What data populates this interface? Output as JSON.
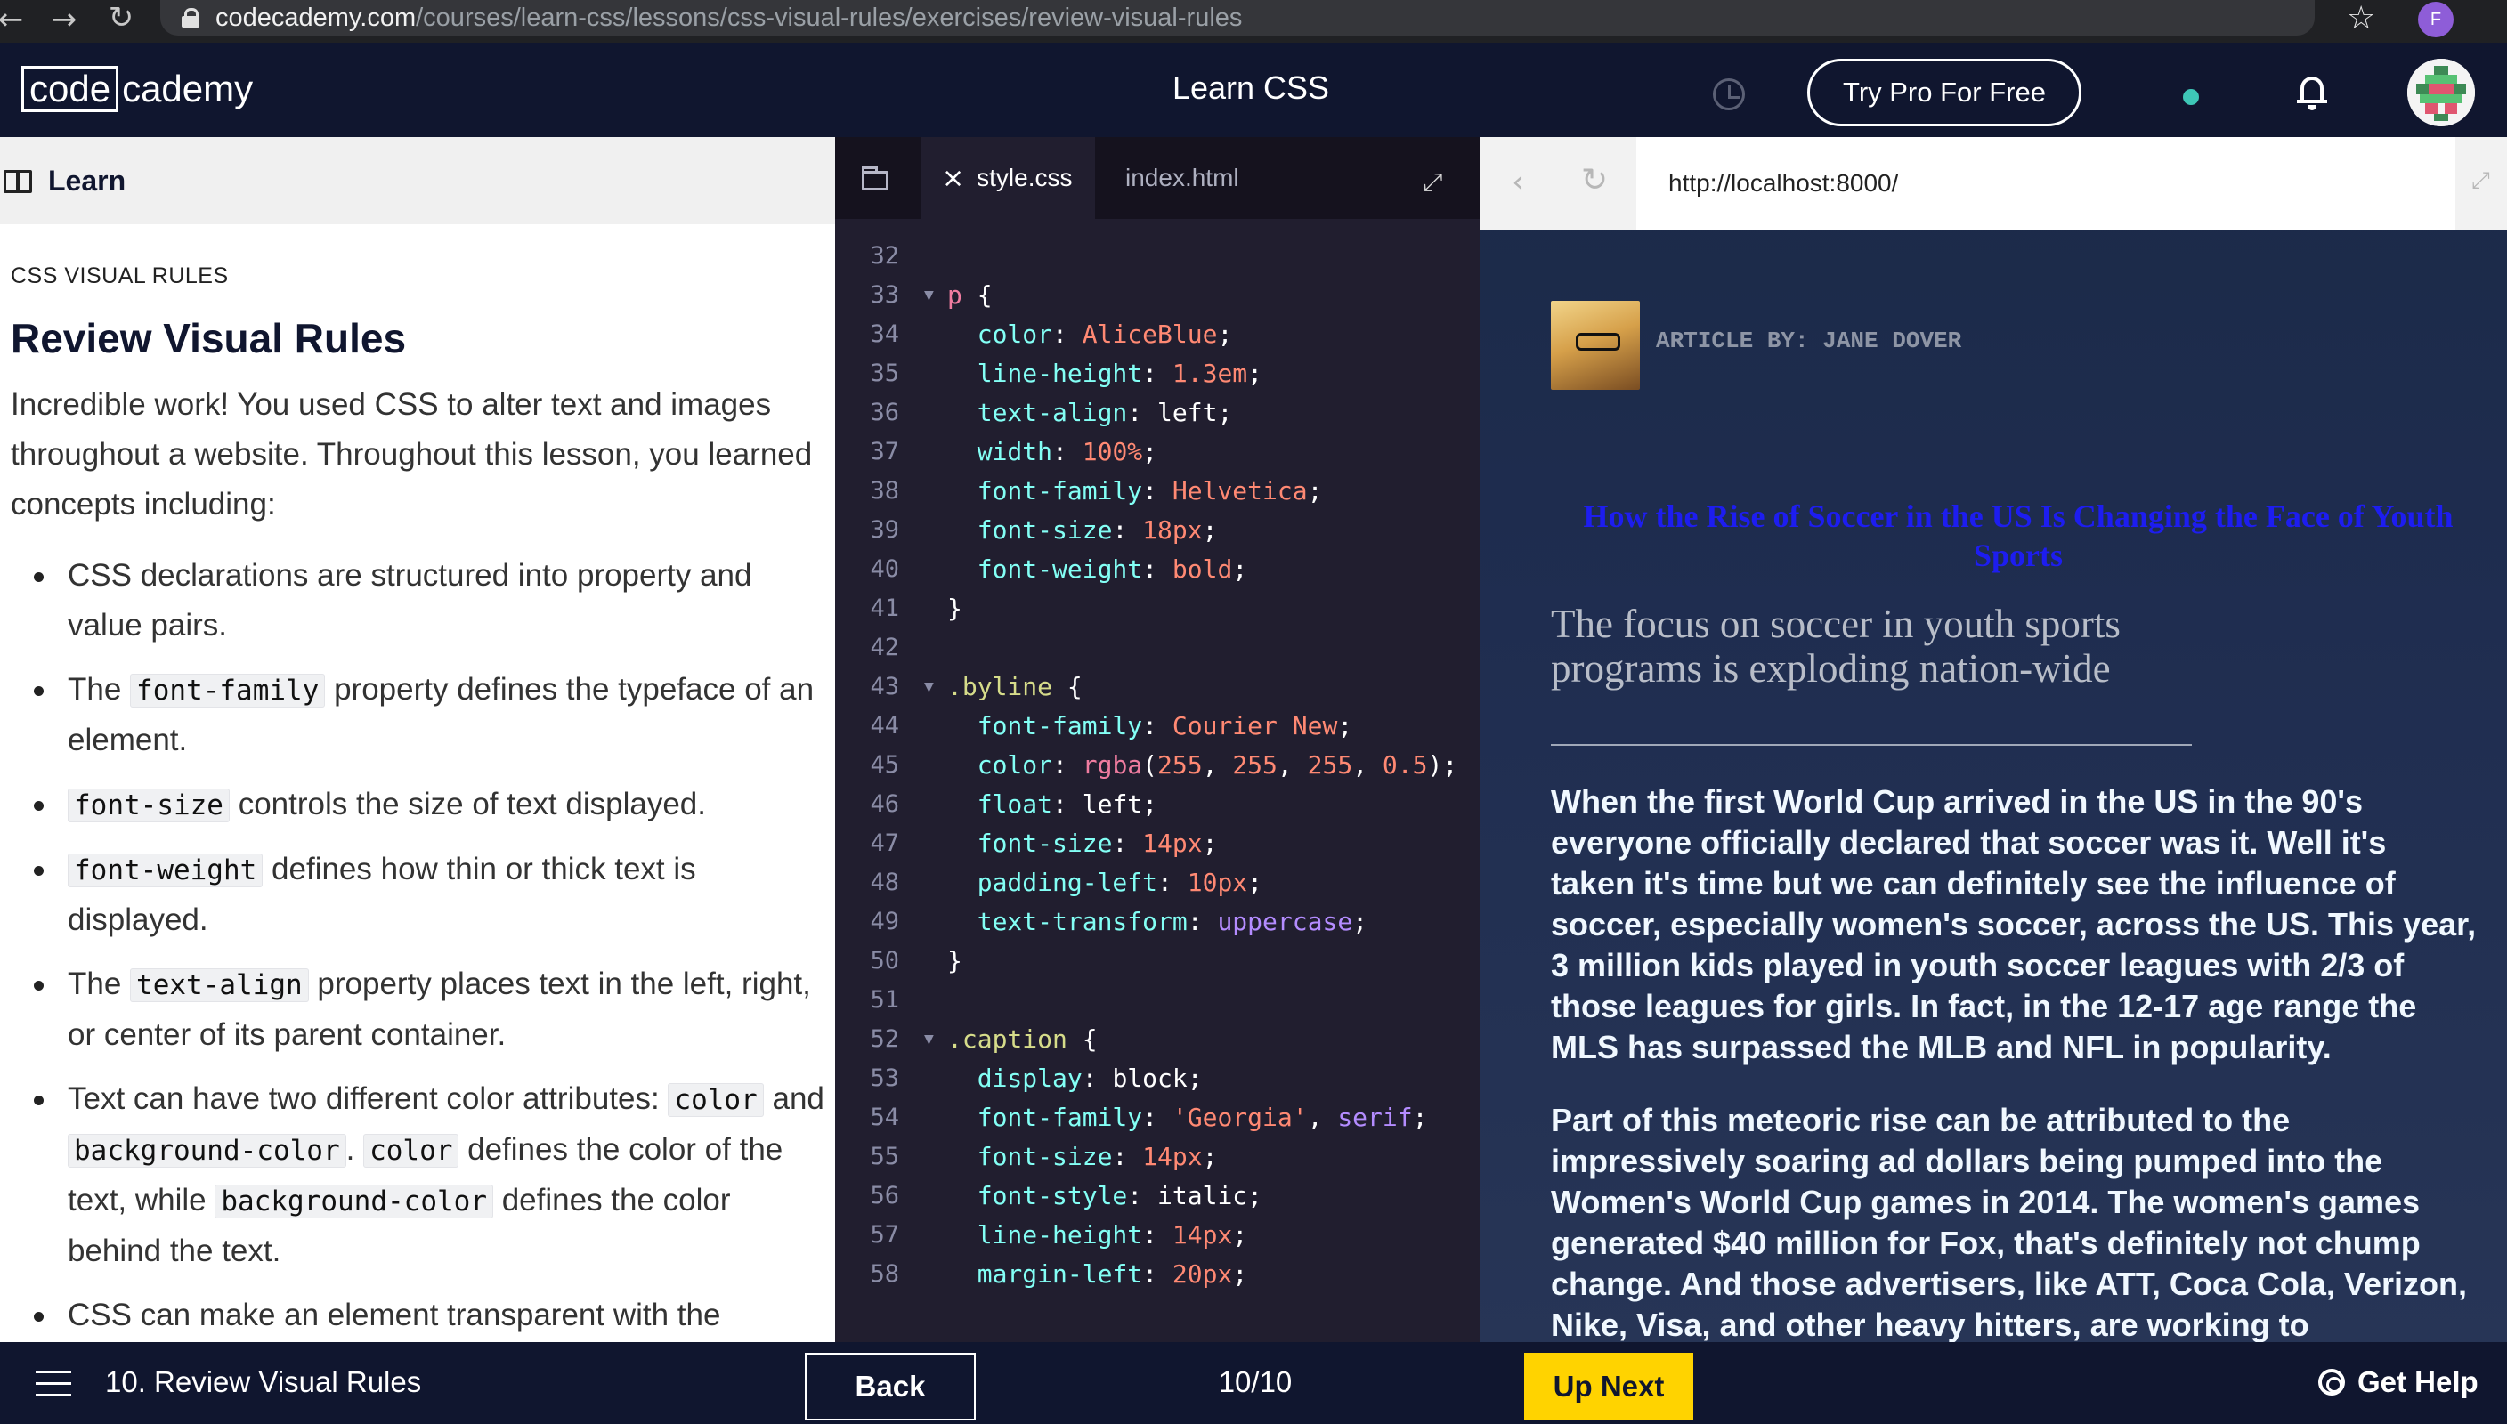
{
  "browser": {
    "back_icon": "arrow-left",
    "forward_icon": "arrow-right",
    "reload_icon": "reload",
    "url_host": "codecademy.com",
    "url_path": "/courses/learn-css/lessons/css-visual-rules/exercises/review-visual-rules",
    "profile_initial": "F",
    "profile_color": "#8e5dd8"
  },
  "header": {
    "logo_code": "code",
    "logo_academy": "cademy",
    "title": "Learn CSS",
    "pro_button": "Try Pro For Free",
    "accent_dot_color": "#3ec7b7"
  },
  "learn": {
    "panel_label": "Learn",
    "section": "CSS VISUAL RULES",
    "title": "Review Visual Rules",
    "intro": "Incredible work! You used CSS to alter text and images throughout a website. Throughout this lesson, you learned concepts including:",
    "bullets": {
      "b1": "CSS declarations are structured into property and value pairs.",
      "b2_pre": "The ",
      "b2_code": "font-family",
      "b2_post": " property defines the typeface of an element.",
      "b3_code": "font-size",
      "b3_post": " controls the size of text displayed.",
      "b4_code": "font-weight",
      "b4_post": " defines how thin or thick text is displayed.",
      "b5_pre": "The ",
      "b5_code": "text-align",
      "b5_post": " property places text in the left, right, or center of its parent container.",
      "b6_pre": "Text can have two different color attributes: ",
      "b6_code1": "color",
      "b6_mid1": " and ",
      "b6_code2": "background-color",
      "b6_mid2": ". ",
      "b6_code3": "color",
      "b6_mid3": " defines the color of the text, while ",
      "b6_code4": "background-color",
      "b6_post": " defines the color behind the text.",
      "b7": "CSS can make an element transparent with the"
    }
  },
  "editor": {
    "tab_active": "style.css",
    "tab_inactive": "index.html",
    "lines": [
      {
        "n": "32",
        "fold": false,
        "parts": []
      },
      {
        "n": "33",
        "fold": true,
        "parts": [
          [
            "sel",
            "p"
          ],
          [
            "pun",
            " {"
          ]
        ]
      },
      {
        "n": "34",
        "fold": false,
        "parts": [
          [
            "pun",
            "  "
          ],
          [
            "prop",
            "color"
          ],
          [
            "pun",
            ": "
          ],
          [
            "val",
            "AliceBlue"
          ],
          [
            "pun",
            ";"
          ]
        ]
      },
      {
        "n": "35",
        "fold": false,
        "parts": [
          [
            "pun",
            "  "
          ],
          [
            "prop",
            "line-height"
          ],
          [
            "pun",
            ": "
          ],
          [
            "num",
            "1.3em"
          ],
          [
            "pun",
            ";"
          ]
        ]
      },
      {
        "n": "36",
        "fold": false,
        "parts": [
          [
            "pun",
            "  "
          ],
          [
            "prop",
            "text-align"
          ],
          [
            "pun",
            ": "
          ],
          [
            "pun",
            "left"
          ],
          [
            "pun",
            ";"
          ]
        ]
      },
      {
        "n": "37",
        "fold": false,
        "parts": [
          [
            "pun",
            "  "
          ],
          [
            "prop",
            "width"
          ],
          [
            "pun",
            ": "
          ],
          [
            "num",
            "100%"
          ],
          [
            "pun",
            ";"
          ]
        ]
      },
      {
        "n": "38",
        "fold": false,
        "parts": [
          [
            "pun",
            "  "
          ],
          [
            "prop",
            "font-family"
          ],
          [
            "pun",
            ": "
          ],
          [
            "val",
            "Helvetica"
          ],
          [
            "pun",
            ";"
          ]
        ]
      },
      {
        "n": "39",
        "fold": false,
        "parts": [
          [
            "pun",
            "  "
          ],
          [
            "prop",
            "font-size"
          ],
          [
            "pun",
            ": "
          ],
          [
            "num",
            "18px"
          ],
          [
            "pun",
            ";"
          ]
        ]
      },
      {
        "n": "40",
        "fold": false,
        "parts": [
          [
            "pun",
            "  "
          ],
          [
            "prop",
            "font-weight"
          ],
          [
            "pun",
            ": "
          ],
          [
            "val",
            "bold"
          ],
          [
            "pun",
            ";"
          ]
        ]
      },
      {
        "n": "41",
        "fold": false,
        "parts": [
          [
            "pun",
            "}"
          ]
        ]
      },
      {
        "n": "42",
        "fold": false,
        "parts": []
      },
      {
        "n": "43",
        "fold": true,
        "parts": [
          [
            "cls",
            ".byline"
          ],
          [
            "pun",
            " {"
          ]
        ]
      },
      {
        "n": "44",
        "fold": false,
        "parts": [
          [
            "pun",
            "  "
          ],
          [
            "prop",
            "font-family"
          ],
          [
            "pun",
            ": "
          ],
          [
            "val",
            "Courier New"
          ],
          [
            "pun",
            ";"
          ]
        ]
      },
      {
        "n": "45",
        "fold": false,
        "parts": [
          [
            "pun",
            "  "
          ],
          [
            "prop",
            "color"
          ],
          [
            "pun",
            ": "
          ],
          [
            "sel",
            "rgba"
          ],
          [
            "pun",
            "("
          ],
          [
            "num",
            "255"
          ],
          [
            "pun",
            ", "
          ],
          [
            "num",
            "255"
          ],
          [
            "pun",
            ", "
          ],
          [
            "num",
            "255"
          ],
          [
            "pun",
            ", "
          ],
          [
            "num",
            "0.5"
          ],
          [
            "pun",
            ");"
          ]
        ]
      },
      {
        "n": "46",
        "fold": false,
        "parts": [
          [
            "pun",
            "  "
          ],
          [
            "prop",
            "float"
          ],
          [
            "pun",
            ": "
          ],
          [
            "pun",
            "left"
          ],
          [
            "pun",
            ";"
          ]
        ]
      },
      {
        "n": "47",
        "fold": false,
        "parts": [
          [
            "pun",
            "  "
          ],
          [
            "prop",
            "font-size"
          ],
          [
            "pun",
            ": "
          ],
          [
            "num",
            "14px"
          ],
          [
            "pun",
            ";"
          ]
        ]
      },
      {
        "n": "48",
        "fold": false,
        "parts": [
          [
            "pun",
            "  "
          ],
          [
            "prop",
            "padding-left"
          ],
          [
            "pun",
            ": "
          ],
          [
            "num",
            "10px"
          ],
          [
            "pun",
            ";"
          ]
        ]
      },
      {
        "n": "49",
        "fold": false,
        "parts": [
          [
            "pun",
            "  "
          ],
          [
            "prop",
            "text-transform"
          ],
          [
            "pun",
            ": "
          ],
          [
            "kw",
            "uppercase"
          ],
          [
            "pun",
            ";"
          ]
        ]
      },
      {
        "n": "50",
        "fold": false,
        "parts": [
          [
            "pun",
            "}"
          ]
        ]
      },
      {
        "n": "51",
        "fold": false,
        "parts": []
      },
      {
        "n": "52",
        "fold": true,
        "parts": [
          [
            "cls",
            ".caption"
          ],
          [
            "pun",
            " {"
          ]
        ]
      },
      {
        "n": "53",
        "fold": false,
        "parts": [
          [
            "pun",
            "  "
          ],
          [
            "prop",
            "display"
          ],
          [
            "pun",
            ": "
          ],
          [
            "pun",
            "block"
          ],
          [
            "pun",
            ";"
          ]
        ]
      },
      {
        "n": "54",
        "fold": false,
        "parts": [
          [
            "pun",
            "  "
          ],
          [
            "prop",
            "font-family"
          ],
          [
            "pun",
            ": "
          ],
          [
            "val",
            "'Georgia'"
          ],
          [
            "pun",
            ", "
          ],
          [
            "kw",
            "serif"
          ],
          [
            "pun",
            ";"
          ]
        ]
      },
      {
        "n": "55",
        "fold": false,
        "parts": [
          [
            "pun",
            "  "
          ],
          [
            "prop",
            "font-size"
          ],
          [
            "pun",
            ": "
          ],
          [
            "num",
            "14px"
          ],
          [
            "pun",
            ";"
          ]
        ]
      },
      {
        "n": "56",
        "fold": false,
        "parts": [
          [
            "pun",
            "  "
          ],
          [
            "prop",
            "font-style"
          ],
          [
            "pun",
            ": "
          ],
          [
            "pun",
            "italic"
          ],
          [
            "pun",
            ";"
          ]
        ]
      },
      {
        "n": "57",
        "fold": false,
        "parts": [
          [
            "pun",
            "  "
          ],
          [
            "prop",
            "line-height"
          ],
          [
            "pun",
            ": "
          ],
          [
            "num",
            "14px"
          ],
          [
            "pun",
            ";"
          ]
        ]
      },
      {
        "n": "58",
        "fold": false,
        "parts": [
          [
            "pun",
            "  "
          ],
          [
            "prop",
            "margin-left"
          ],
          [
            "pun",
            ": "
          ],
          [
            "num",
            "20px"
          ],
          [
            "pun",
            ";"
          ]
        ]
      }
    ]
  },
  "preview": {
    "url": "http://localhost:8000/",
    "byline": "Article By: Jane Dover",
    "headline": "How the Rise of Soccer in the US Is Changing the Face of Youth Sports",
    "subhead": "The focus on soccer in youth sports programs is exploding nation-wide",
    "para1": "When the first World Cup arrived in the US in the 90's everyone officially declared that soccer was it. Well it's taken it's time but we can definitely see the influence of soccer, especially women's soccer, across the US. This year, 3 million kids played in youth soccer leagues with 2/3 of those leagues for girls. In fact, in the 12-17 age range the MLS has surpassed the MLB and NFL in popularity.",
    "para2": "Part of this meteoric rise can be attributed to the impressively soaring ad dollars being pumped into the Women's World Cup games in 2014. The women's games generated $40 million for Fox, that's definitely not chump change. And those advertisers, like ATT, Coca Cola, Verizon, Nike, Visa, and other heavy hitters, are working to"
  },
  "footer": {
    "lesson": "10. Review Visual Rules",
    "back": "Back",
    "progress": "10/10",
    "next": "Up Next",
    "help": "Get Help",
    "next_color": "#ffd300"
  }
}
